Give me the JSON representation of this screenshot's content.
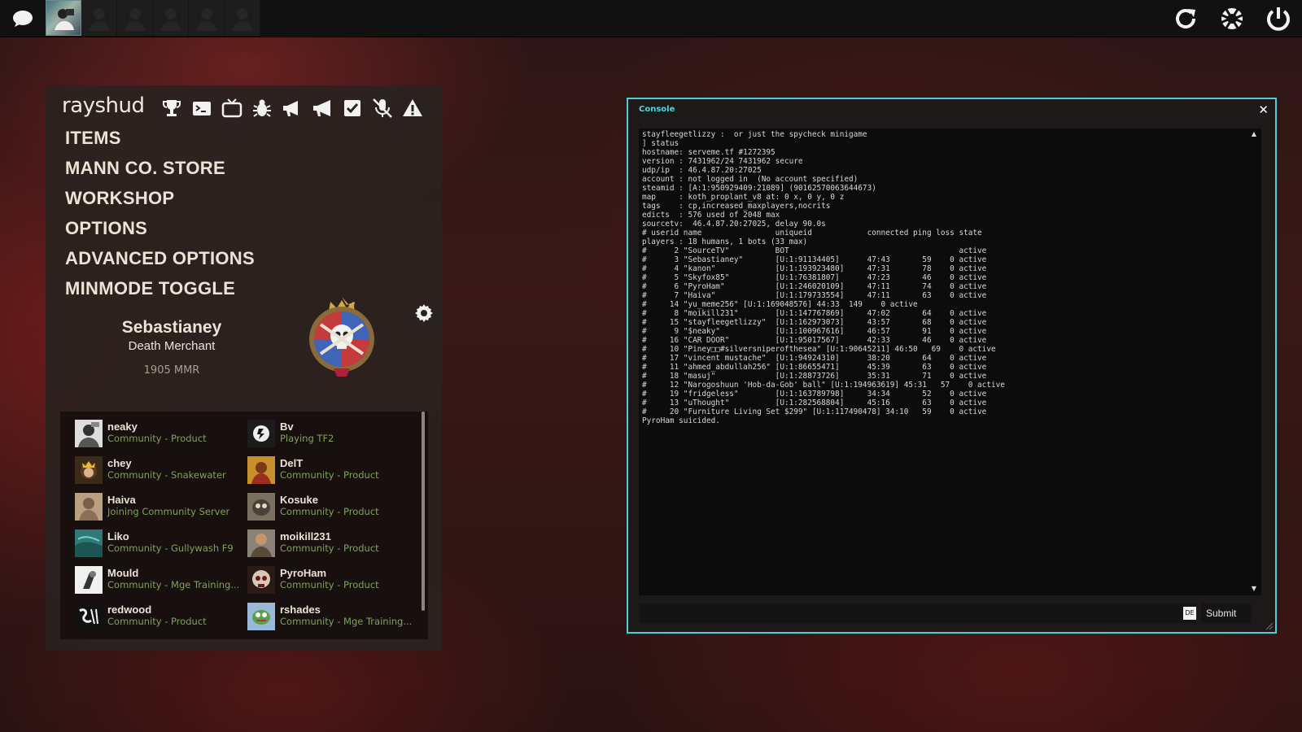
{
  "topbar": {
    "icons": [
      "chat-bubble-icon",
      "refresh-icon",
      "lifebuoy-icon",
      "power-icon"
    ]
  },
  "panel": {
    "username": "rayshud",
    "icons": [
      "trophy-icon",
      "terminal-icon",
      "tv-icon",
      "bug-icon",
      "megaphone-icon",
      "megaphone-2-icon",
      "checkbox-icon",
      "mic-off-icon",
      "warning-icon"
    ],
    "menu": [
      "ITEMS",
      "MANN CO. STORE",
      "WORKSHOP",
      "OPTIONS",
      "ADVANCED OPTIONS",
      "MINMODE TOGGLE"
    ],
    "profile": {
      "name": "Sebastianey",
      "title": "Death Merchant",
      "mmr": "1905 MMR"
    },
    "friends": [
      {
        "name": "neaky",
        "status": "Community - Product"
      },
      {
        "name": "Bv",
        "status": "Playing TF2"
      },
      {
        "name": "chey",
        "status": "Community - Snakewater"
      },
      {
        "name": "DelT",
        "status": "Community - Product"
      },
      {
        "name": "Haiva",
        "status": "Joining Community Server"
      },
      {
        "name": "Kosuke",
        "status": "Community - Product"
      },
      {
        "name": "Liko",
        "status": "Community - Gullywash F9"
      },
      {
        "name": "moikill231",
        "status": "Community - Product"
      },
      {
        "name": "Mould",
        "status": "Community - Mge Training..."
      },
      {
        "name": "PyroHam",
        "status": "Community - Product"
      },
      {
        "name": "redwood",
        "status": "Community - Product"
      },
      {
        "name": "rshades",
        "status": "Community - Mge Training..."
      }
    ],
    "colors": {
      "status_green": "#7fa358",
      "panel_bg": "#2a221f"
    }
  },
  "console": {
    "title": "Console",
    "close": "✕",
    "lines": [
      "stayfleegetlizzy :  or just the spycheck minigame",
      "] status",
      "hostname: serveme.tf #1272395",
      "version : 7431962/24 7431962 secure",
      "udp/ip  : 46.4.87.20:27025",
      "account : not logged in  (No account specified)",
      "steamid : [A:1:950929409:21089] (90162570063644673)",
      "map     : koth_proplant_v8 at: 0 x, 0 y, 0 z",
      "tags    : cp,increased_maxplayers,nocrits",
      "edicts  : 576 used of 2048 max",
      "sourcetv:  46.4.87.20:27025, delay 90.0s",
      "# userid name                uniqueid            connected ping loss state",
      "players : 18 humans, 1 bots (33 max)",
      "#      2 \"SourceTV\"          BOT                                     active",
      "#      3 \"Sebastianey\"       [U:1:91134405]      47:43       59    0 active",
      "#      4 \"kanon\"             [U:1:193923480]     47:31       78    0 active",
      "#      5 \"Skyfox85\"          [U:1:76381807]      47:23       46    0 active",
      "#      6 \"PyroHam\"           [U:1:246020109]     47:11       74    0 active",
      "#      7 \"Haiva\"             [U:1:179733554]     47:11       63    0 active",
      "#     14 \"yu_meme256\" [U:1:169048576] 44:33  149    0 active",
      "#      8 \"moikill231\"        [U:1:147767869]     47:02       64    0 active",
      "#     15 \"stayfleegetlizzy\"  [U:1:162973073]     43:57       68    0 active",
      "#      9 \"$neaky\"            [U:1:100967616]     46:57       91    0 active",
      "#     16 \"CAR DOOR\"          [U:1:95017567]      42:33       46    0 active",
      "#     10 \"Piney□□#silversniperofthesea\" [U:1:90645211] 46:50   69    0 active",
      "#     17 \"vincent mustache\"  [U:1:94924310]      38:20       64    0 active",
      "#     11 \"ahmed_abdullah256\" [U:1:86655471]      45:39       63    0 active",
      "#     18 \"masuj\"             [U:1:28873726]      35:31       71    0 active",
      "#     12 \"Narogoshuun 'Hob-da-Gob' ball\" [U:1:194963619] 45:31   57    0 active",
      "#     19 \"fridgeless\"        [U:1:163789798]     34:34       52    0 active",
      "#     13 \"uThought\"          [U:1:282568804]     45:16       63    0 active",
      "#     20 \"Furniture Living Set $299\" [U:1:117490478] 34:10   59    0 active",
      "PyroHam suicided."
    ],
    "input_value": "",
    "lang": "DE",
    "submit": "Submit"
  }
}
